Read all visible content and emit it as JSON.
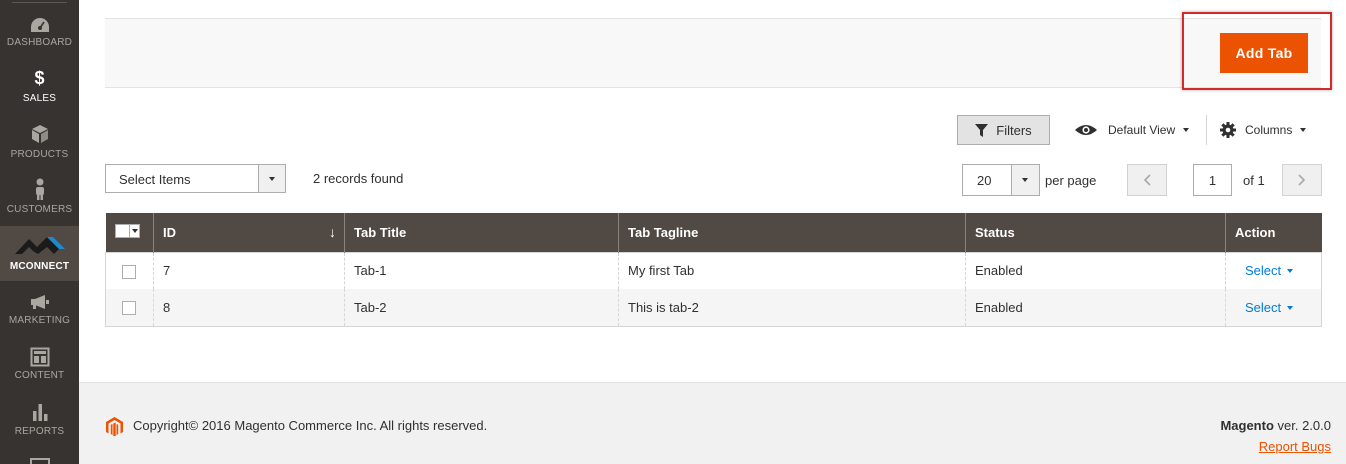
{
  "sidebar": {
    "items": [
      {
        "label": "DASHBOARD",
        "icon": "dashboard-icon"
      },
      {
        "label": "SALES",
        "icon": "dollar-icon"
      },
      {
        "label": "PRODUCTS",
        "icon": "cube-icon"
      },
      {
        "label": "CUSTOMERS",
        "icon": "person-icon"
      },
      {
        "label": "MCONNECT",
        "icon": "mconnect-logo-icon",
        "active": true
      },
      {
        "label": "MARKETING",
        "icon": "megaphone-icon"
      },
      {
        "label": "CONTENT",
        "icon": "layout-icon"
      },
      {
        "label": "REPORTS",
        "icon": "bar-chart-icon"
      }
    ]
  },
  "page_actions": {
    "add_tab_label": "Add Tab"
  },
  "toolbar": {
    "filters_label": "Filters",
    "view_label": "Default View",
    "columns_label": "Columns",
    "mass_action_placeholder": "Select Items",
    "records_found": "2 records found",
    "per_page_value": "20",
    "per_page_label": "per page",
    "current_page": "1",
    "total_pages_label": "of 1"
  },
  "grid": {
    "columns": [
      "ID",
      "Tab Title",
      "Tab Tagline",
      "Status",
      "Action"
    ],
    "sort_indicator": "↓",
    "rows": [
      {
        "id": "7",
        "title": "Tab-1",
        "tagline": "My first Tab",
        "status": "Enabled",
        "action": "Select"
      },
      {
        "id": "8",
        "title": "Tab-2",
        "tagline": "This is tab-2",
        "status": "Enabled",
        "action": "Select"
      }
    ]
  },
  "footer": {
    "copyright": "Copyright© 2016 Magento Commerce Inc. All rights reserved.",
    "brand": "Magento",
    "version": " ver. 2.0.0",
    "report_bugs": "Report Bugs"
  },
  "colors": {
    "accent": "#eb5202",
    "sidebar_bg": "#373330",
    "grid_header_bg": "#514943",
    "link": "#007bdb",
    "highlight_border": "#d12b2b"
  }
}
